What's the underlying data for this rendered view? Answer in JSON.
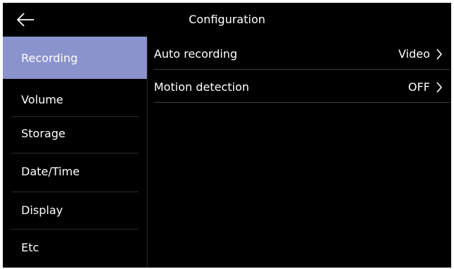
{
  "header": {
    "title": "Configuration",
    "back_icon": "arrow-left-icon"
  },
  "sidebar": {
    "active_color": "#8b93cc",
    "items": [
      {
        "label": "Recording",
        "active": true
      },
      {
        "label": "Volume",
        "active": false
      },
      {
        "label": "Storage",
        "active": false
      },
      {
        "label": "Date/Time",
        "active": false
      },
      {
        "label": "Display",
        "active": false
      },
      {
        "label": "Etc",
        "active": false
      }
    ]
  },
  "settings": {
    "rows": [
      {
        "label": "Auto recording",
        "value": "Video",
        "icon": "chevron-right-icon"
      },
      {
        "label": "Motion detection",
        "value": "OFF",
        "icon": "chevron-right-icon"
      }
    ]
  }
}
